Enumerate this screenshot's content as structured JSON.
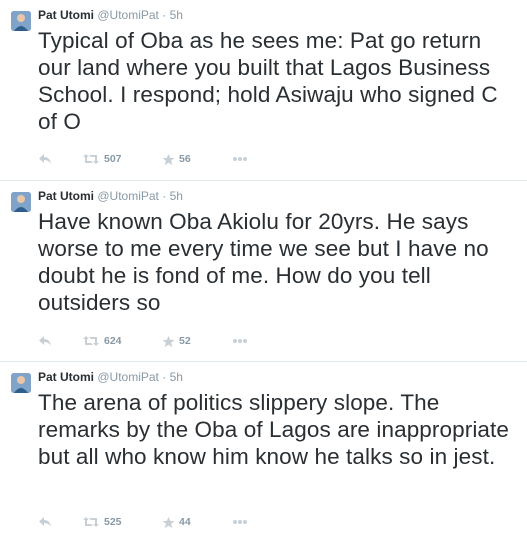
{
  "tweets": [
    {
      "fullname": "Pat Utomi",
      "username": "@UtomiPat",
      "sep": "·",
      "time": "5h",
      "text": "Typical of Oba as he sees me: Pat go return our land where you built that Lagos Business School. I respond; hold Asiwaju who signed C of O",
      "retweets": "507",
      "favorites": "56"
    },
    {
      "fullname": "Pat Utomi",
      "username": "@UtomiPat",
      "sep": "·",
      "time": "5h",
      "text": "Have known Oba Akiolu for 20yrs. He says worse to me every time we see but I have no doubt he is fond of me. How do you tell outsiders so",
      "retweets": "624",
      "favorites": "52"
    },
    {
      "fullname": "Pat Utomi",
      "username": "@UtomiPat",
      "sep": "·",
      "time": "5h",
      "text": "The arena of politics slippery slope. The remarks by the Oba of Lagos are inappropriate but all who know him know he talks so in jest.",
      "retweets": "525",
      "favorites": "44"
    }
  ],
  "icons": {
    "reply": "reply-icon",
    "retweet": "retweet-icon",
    "favorite": "star-icon",
    "more": "more-icon"
  },
  "colors": {
    "name": "#292f33",
    "meta": "#8899a6",
    "icon": "#c8d0d6",
    "divider": "#e1e8ed"
  }
}
